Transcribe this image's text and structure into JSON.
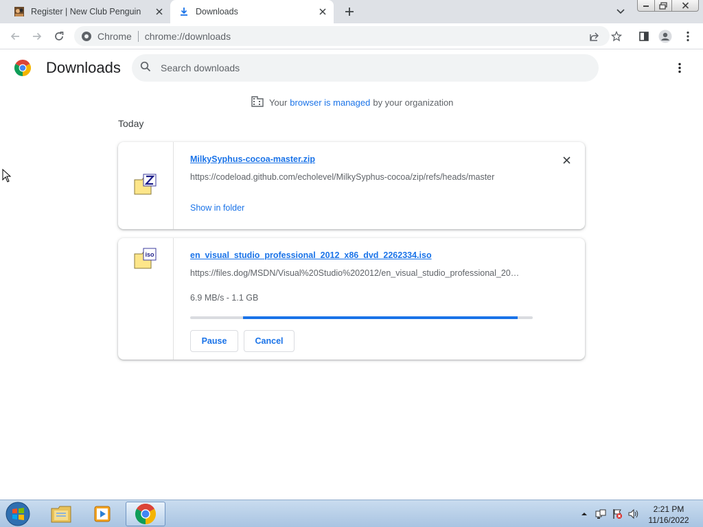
{
  "browser": {
    "tabs": [
      {
        "title": "Register | New Club Penguin",
        "active": false
      },
      {
        "title": "Downloads",
        "active": true
      }
    ],
    "omnibox": {
      "chip": "Chrome",
      "url": "chrome://downloads"
    }
  },
  "page": {
    "title": "Downloads",
    "search": {
      "placeholder": "Search downloads",
      "value": ""
    },
    "managed_notice": {
      "before": "Your",
      "link": "browser is managed",
      "after": "by your organization"
    },
    "section_label": "Today"
  },
  "downloads": [
    {
      "filename": "MilkySyphus-cocoa-master.zip",
      "url": "https://codeload.github.com/echolevel/MilkySyphus-cocoa/zip/refs/heads/master",
      "action": "Show in folder",
      "icon": "zip-file-icon"
    },
    {
      "filename": "en_visual_studio_professional_2012_x86_dvd_2262334.iso",
      "url": "https://files.dog/MSDN/Visual%20Studio%202012/en_visual_studio_professional_20…",
      "status": "6.9 MB/s - 1.1 GB",
      "progress_percent": 80,
      "pause_label": "Pause",
      "cancel_label": "Cancel",
      "icon": "iso-file-icon"
    }
  ],
  "taskbar": {
    "apps": [
      "windows-explorer-icon",
      "media-player-icon",
      "chrome-icon"
    ],
    "clock": {
      "time": "2:21 PM",
      "date": "11/16/2022"
    }
  },
  "colors": {
    "accent": "#1a73e8",
    "tab_strip": "#dee1e6",
    "taskbar": "#b8cfe8"
  }
}
